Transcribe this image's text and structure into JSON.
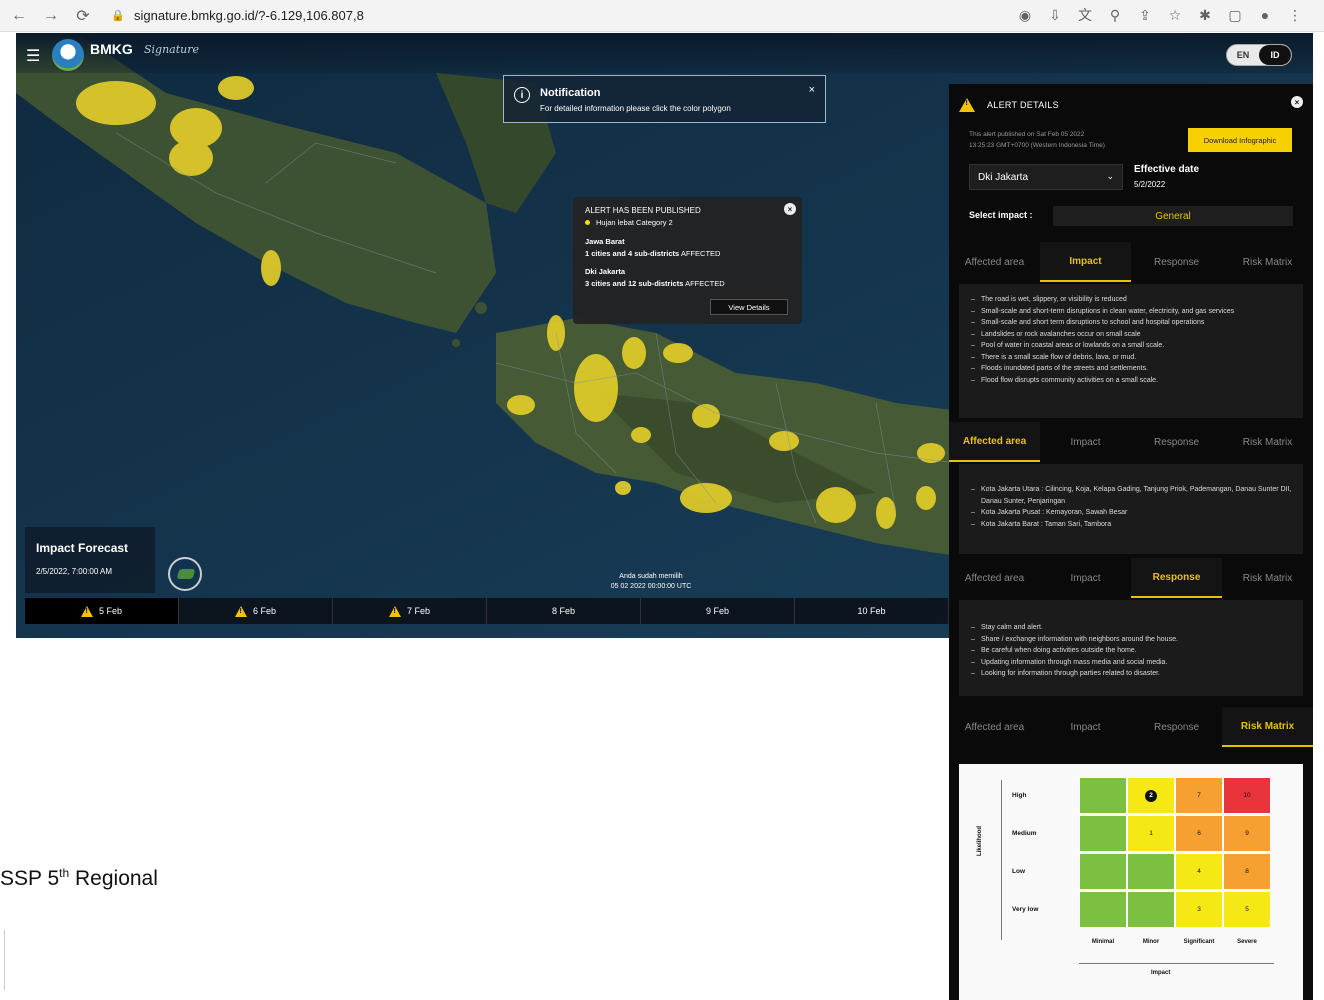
{
  "browser": {
    "url": "signature.bmkg.go.id/?-6.129,106.807,8"
  },
  "app": {
    "brand": "BMKG",
    "brand_sub": "Signature",
    "lang": [
      "EN",
      "ID"
    ]
  },
  "notification": {
    "title": "Notification",
    "message": "For detailed information please click the color polygon",
    "close": "×"
  },
  "map_popup": {
    "heading": "ALERT HAS BEEN PUBLISHED",
    "category": "Hujan lebat Category 2",
    "province1": "Jawa Barat",
    "province1_cities": "1 cities and",
    "province1_subdistricts": "4 sub-districts",
    "province1_status": "AFFECTED",
    "province2": "Dki Jakarta",
    "province2_cities": "3 cities and",
    "province2_subdistricts": "12 sub-districts",
    "province2_status": "AFFECTED",
    "view_details": "View Details",
    "close": "×"
  },
  "impact_forecast": {
    "title": "Impact Forecast",
    "datetime": "2/5/2022, 7:00:00 AM"
  },
  "map_note": {
    "line1": "Anda sudah memilih",
    "line2": "05 02 2022 00:00:00 UTC"
  },
  "dates": [
    {
      "label": "5 Feb",
      "warning": true
    },
    {
      "label": "6 Feb",
      "warning": true
    },
    {
      "label": "7 Feb",
      "warning": true
    },
    {
      "label": "8 Feb",
      "warning": false
    },
    {
      "label": "9 Feb",
      "warning": false
    },
    {
      "label": "10 Feb",
      "warning": false
    }
  ],
  "side_text": {
    "prefix": "SSP 5",
    "sup": "th",
    "suffix": " Regional"
  },
  "alert_panel": {
    "title": "ALERT DETAILS",
    "close": "×",
    "published_line1": "This alert published on Sat Feb 05 2022",
    "published_line2": "13:25:23 GMT+0700 (Western Indonesia Time)",
    "download_label": "Download Infographic",
    "province": "Dki Jakarta",
    "effective_label": "Effective date",
    "effective_date": "5/2/2022",
    "select_impact_label": "Select impact :",
    "select_impact_value": "General"
  },
  "tab_labels": [
    "Affected area",
    "Impact",
    "Response",
    "Risk Matrix"
  ],
  "impact_items": [
    "The road is wet, slippery, or visibility is reduced",
    "Small-scale and short-term disruptions in clean water, electricity, and gas services",
    "Small-scale and short term disruptions to school and hospital operations",
    "Landslides or rock avalanches occur on small scale",
    "Pool of water in coastal areas or lowlands on a small scale.",
    "There is a small scale flow of debris, lava, or mud.",
    "Floods inundated parts of the streets and settlements.",
    "Flood flow disrupts community activities on a small scale."
  ],
  "affected_items": [
    "Kota Jakarta Utara : Cilincing, Koja, Kelapa Gading, Tanjung Priok, Pademangan, Danau Sunter DII, Danau Sunter, Penjaringan",
    "Kota Jakarta Pusat : Kemayoran, Sawah Besar",
    "Kota Jakarta Barat : Taman Sari, Tambora"
  ],
  "response_items": [
    "Stay calm and alert.",
    "Share / exchange information with neighbors around the house.",
    "Be careful when doing activities outside the home.",
    "Updating information through mass media and social media.",
    "Looking for information through parties related to disaster."
  ],
  "risk_matrix": {
    "y_label": "Likelihood",
    "x_label": "Impact",
    "rows": [
      "High",
      "Medium",
      "Low",
      "Very low"
    ],
    "cols": [
      "Minimal",
      "Minor",
      "Significant",
      "Severe"
    ],
    "cells": [
      [
        {
          "v": "",
          "c": "#7cc042"
        },
        {
          "v": "2",
          "c": "#f5e814",
          "marker": true
        },
        {
          "v": "7",
          "c": "#f5a030"
        },
        {
          "v": "10",
          "c": "#e8343a"
        }
      ],
      [
        {
          "v": "",
          "c": "#7cc042"
        },
        {
          "v": "1",
          "c": "#f5e814"
        },
        {
          "v": "6",
          "c": "#f5a030"
        },
        {
          "v": "9",
          "c": "#f5a030"
        }
      ],
      [
        {
          "v": "",
          "c": "#7cc042"
        },
        {
          "v": "",
          "c": "#7cc042"
        },
        {
          "v": "4",
          "c": "#f5e814"
        },
        {
          "v": "8",
          "c": "#f5a030"
        }
      ],
      [
        {
          "v": "",
          "c": "#7cc042"
        },
        {
          "v": "",
          "c": "#7cc042"
        },
        {
          "v": "3",
          "c": "#f5e814"
        },
        {
          "v": "5",
          "c": "#f5e814"
        }
      ]
    ]
  },
  "colors": {
    "accent": "#e7c200",
    "alert_yellow": "#f2d21b",
    "panel_bg": "#0a0a0a"
  }
}
